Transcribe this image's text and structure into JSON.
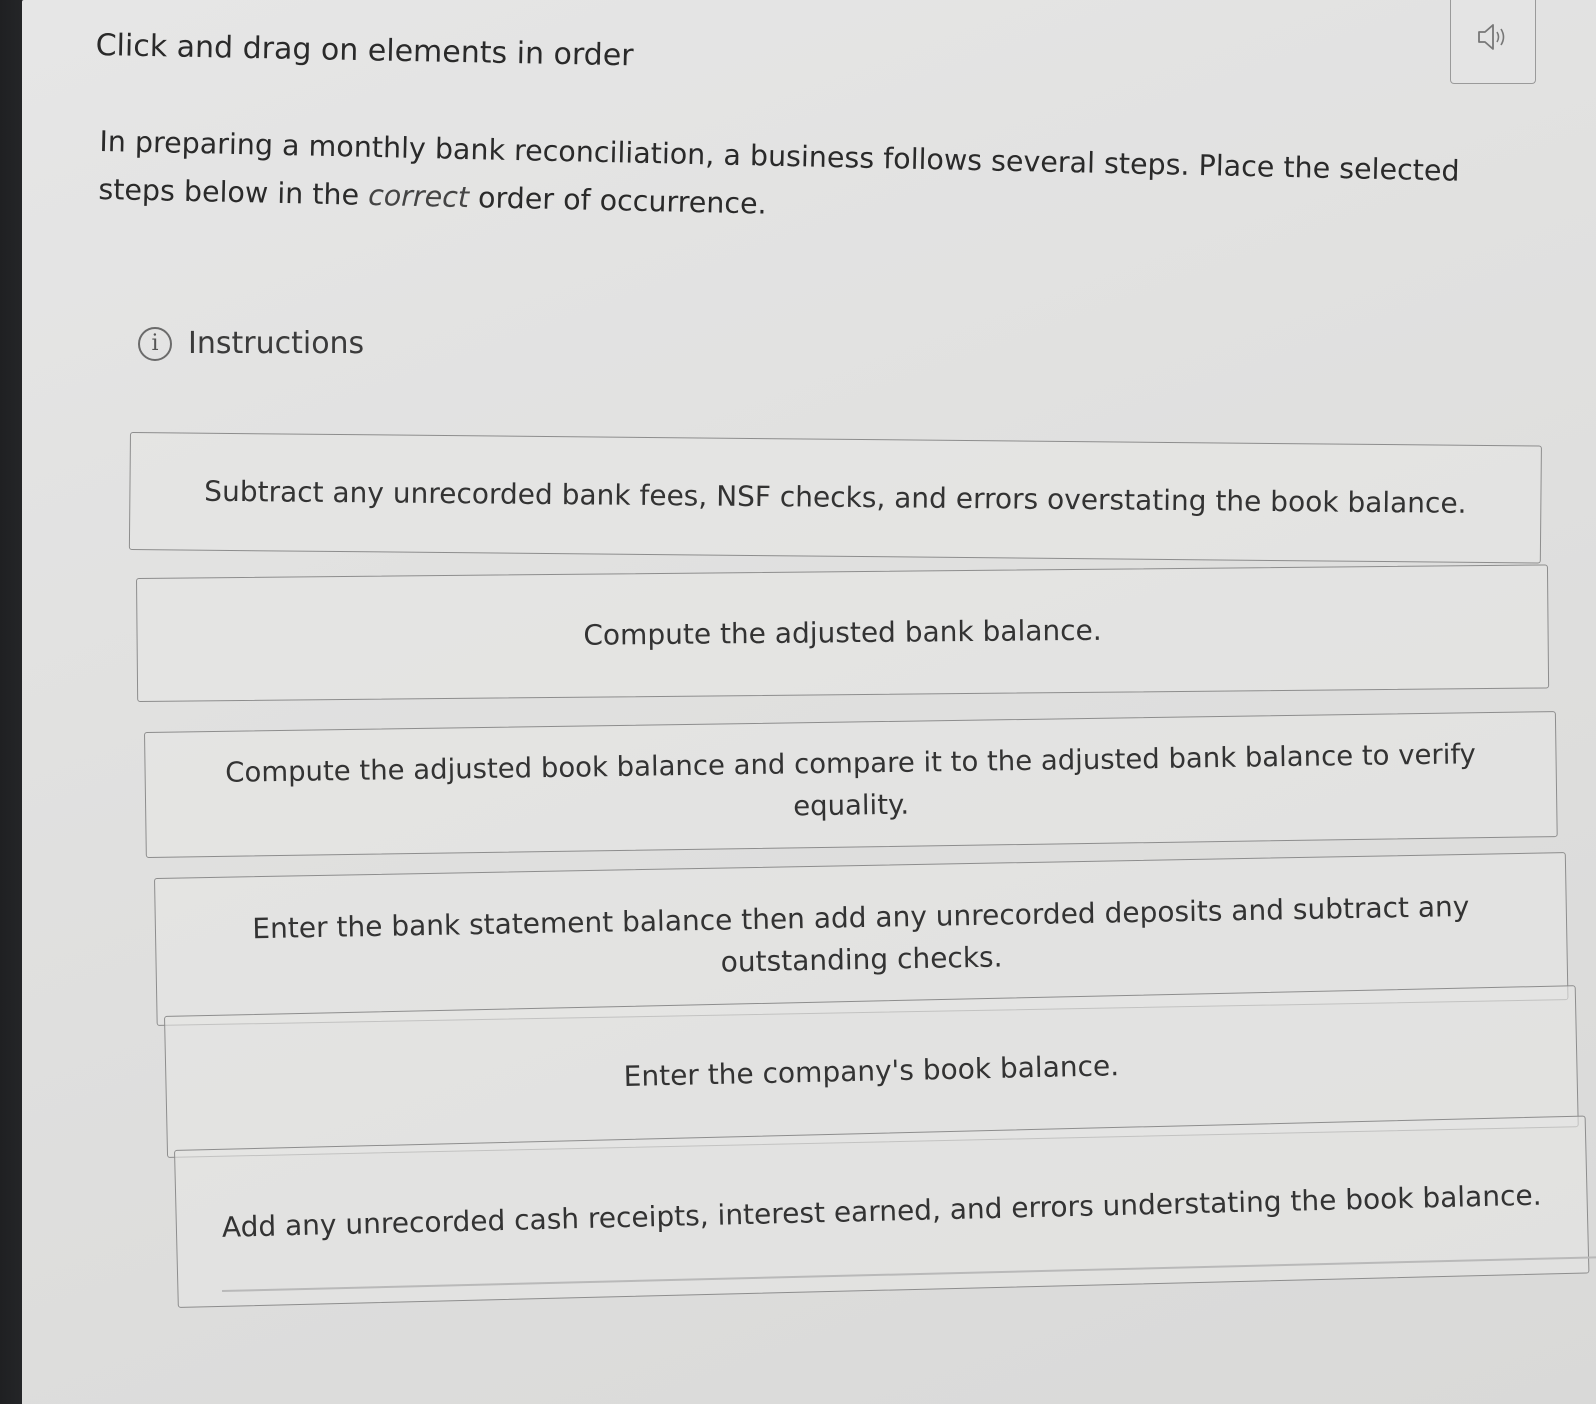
{
  "header": {
    "title": "Click and drag on elements in order"
  },
  "audio": {
    "icon": "speaker-icon"
  },
  "question": {
    "text_before": "In preparing a monthly bank reconciliation, a business follows several steps. Place the selected steps below in the ",
    "emphasis": "correct",
    "text_after": " order of occurrence."
  },
  "instructions": {
    "label": "Instructions",
    "icon": "info-icon"
  },
  "items": [
    {
      "label": "Subtract any unrecorded bank fees, NSF checks, and errors overstating the book balance."
    },
    {
      "label": "Compute the adjusted bank balance."
    },
    {
      "label": "Compute the adjusted book balance and compare it to the adjusted bank balance to verify equality."
    },
    {
      "label": "Enter the bank statement balance then add any unrecorded deposits and subtract any outstanding checks."
    },
    {
      "label": "Enter the company's book balance."
    },
    {
      "label": "Add any unrecorded cash receipts, interest earned, and errors understating the book balance."
    }
  ]
}
